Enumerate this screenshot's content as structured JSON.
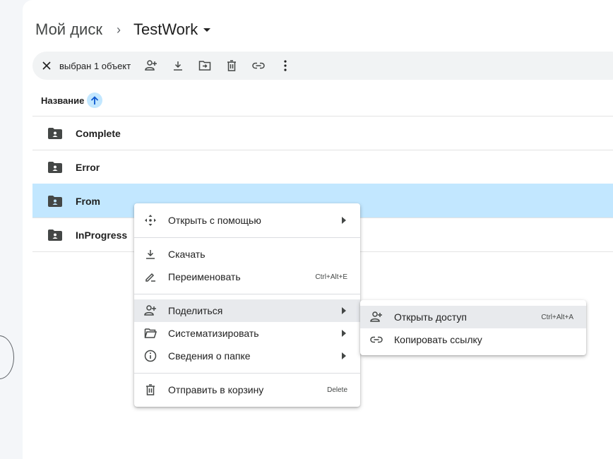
{
  "breadcrumb": {
    "root": "Мой диск",
    "current": "TestWork"
  },
  "actionbar": {
    "selection_text": "выбран 1 объект"
  },
  "list": {
    "column_name": "Название",
    "rows": [
      {
        "name": "Complete",
        "selected": false
      },
      {
        "name": "Error",
        "selected": false
      },
      {
        "name": "From",
        "selected": true
      },
      {
        "name": "InProgress",
        "selected": false
      }
    ]
  },
  "context_menu": {
    "items": [
      {
        "label": "Открыть с помощью",
        "icon": "open-with-icon",
        "submenu": true
      },
      {
        "label": "Скачать",
        "icon": "download-icon"
      },
      {
        "label": "Переименовать",
        "icon": "rename-icon",
        "shortcut": "Ctrl+Alt+E"
      },
      {
        "label": "Поделиться",
        "icon": "share-icon",
        "submenu": true,
        "highlighted": true
      },
      {
        "label": "Систематизировать",
        "icon": "organize-folder-icon",
        "submenu": true
      },
      {
        "label": "Сведения о папке",
        "icon": "info-icon",
        "submenu": true
      },
      {
        "label": "Отправить в корзину",
        "icon": "trash-icon",
        "shortcut": "Delete"
      }
    ]
  },
  "share_submenu": {
    "items": [
      {
        "label": "Открыть доступ",
        "icon": "add-person-icon",
        "shortcut": "Ctrl+Alt+A",
        "highlighted": true
      },
      {
        "label": "Копировать ссылку",
        "icon": "link-icon"
      }
    ]
  },
  "colors": {
    "selection": "#c2e7ff",
    "menu_highlight": "#e8eaed",
    "icon": "#444746"
  }
}
